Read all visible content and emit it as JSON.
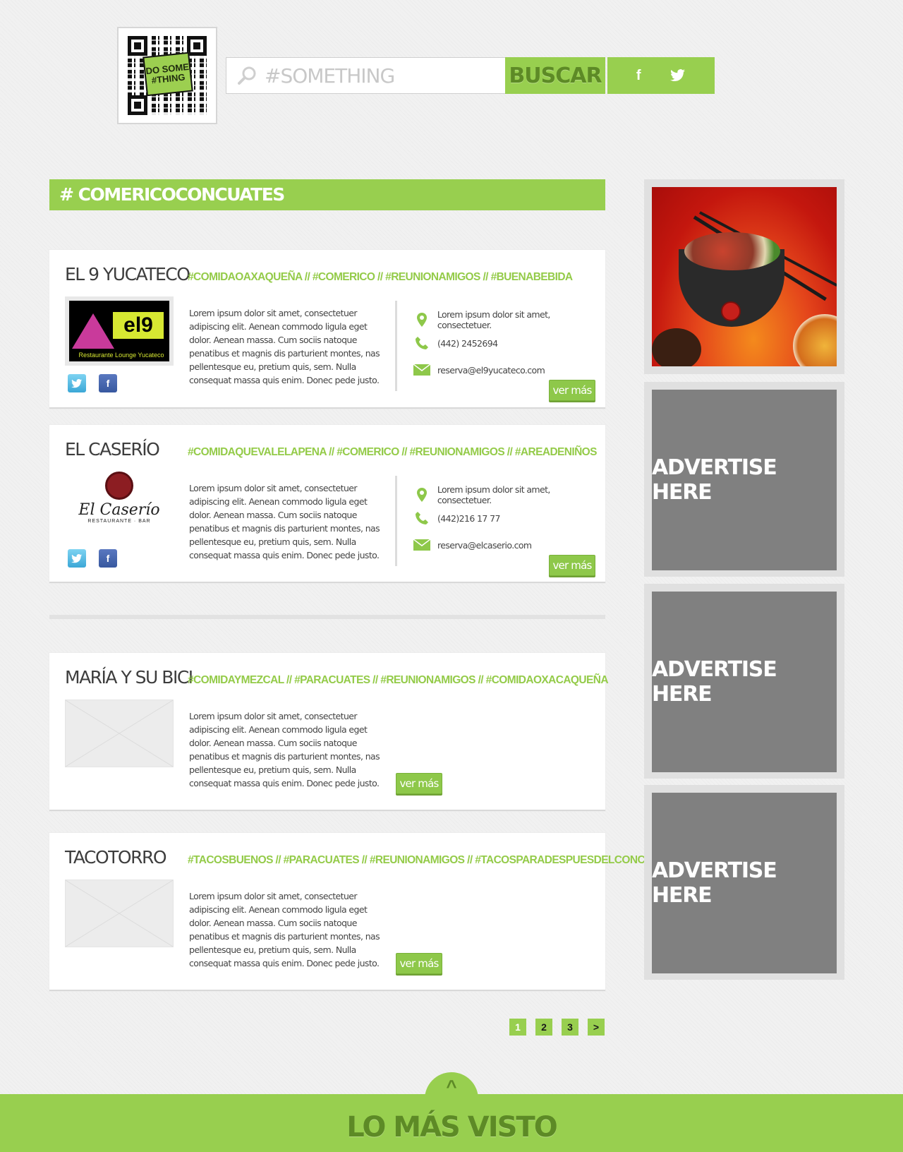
{
  "header": {
    "qr_logo_text": "DO SOME #THING",
    "search_placeholder": "#SOMETHING",
    "search_button": "BUSCAR",
    "social": {
      "facebook": "f",
      "twitter": "t"
    }
  },
  "section": {
    "title": "# COMERICOCONCUATES"
  },
  "cards": [
    {
      "name": "EL 9 YUCATECO",
      "tags": "#COMIDAOAXAQUEÑA // #COMERICO // #REUNIONAMIGOS // #BUENABEBIDA",
      "description": "Lorem ipsum dolor sit amet, consectetuer adipiscing elit. Aenean commodo ligula eget dolor. Aenean massa. Cum sociis natoque penatibus et magnis dis parturient montes, nas pellentesque eu, pretium quis, sem. Nulla consequat massa quis enim. Donec pede justo.",
      "address": "Lorem ipsum dolor sit amet, consectetuer.",
      "phone": "(442) 2452694",
      "email": "reserva@el9yucateco.com",
      "logo_main": "el9",
      "logo_sub": "Restaurante Lounge Yucateco",
      "more": "ver más"
    },
    {
      "name": "EL CASERÍO",
      "tags": "#COMIDAQUEVALELAPENA // #COMERICO // #REUNIONAMIGOS // #AREADENIÑOS",
      "description": "Lorem ipsum dolor sit amet, consectetuer adipiscing elit. Aenean commodo ligula eget dolor. Aenean massa. Cum sociis natoque penatibus et magnis dis parturient montes, nas pellentesque eu, pretium quis, sem. Nulla consequat massa quis enim. Donec pede justo.",
      "address": "Lorem ipsum dolor sit amet, consectetuer.",
      "phone": "(442)216 17 77",
      "email": "reserva@elcaserio.com",
      "logo_main": "El Caserío",
      "logo_sub": "RESTAURANTE · BAR",
      "more": "ver más"
    },
    {
      "name": "MARÍA Y SU BICI",
      "tags": "#COMIDAYMEZCAL  // #PARACUATES // #REUNIONAMIGOS // #COMIDAOXACAQUEÑA",
      "description": "Lorem ipsum dolor sit amet, consectetuer adipiscing elit. Aenean commodo ligula eget dolor. Aenean massa. Cum sociis natoque penatibus et magnis dis parturient montes, nas pellentesque eu, pretium quis, sem. Nulla consequat massa quis enim. Donec pede justo.",
      "more": "ver más"
    },
    {
      "name": "TACOTORRO",
      "tags": "#TACOSBUENOS  // #PARACUATES // #REUNIONAMIGOS //  #TACOSPARADESPUESDELCONCIERTO",
      "description": "Lorem ipsum dolor sit amet, consectetuer adipiscing elit. Aenean commodo ligula eget dolor. Aenean massa. Cum sociis natoque penatibus et magnis dis parturient montes, nas pellentesque eu, pretium quis, sem. Nulla consequat massa quis enim. Donec pede justo.",
      "more": "ver más"
    }
  ],
  "pagination": {
    "pages": [
      "1",
      "2",
      "3"
    ],
    "next": ">",
    "current": "1"
  },
  "sidebar": {
    "ads": [
      "ADVERTISE HERE",
      "ADVERTISE HERE",
      "ADVERTISE HERE"
    ]
  },
  "footer": {
    "arrow": "^",
    "title": "LO MÁS VISTO"
  },
  "colors": {
    "accent": "#98cf4f",
    "accent_dark": "#5d8a26",
    "ad_gray": "#808080",
    "text": "#3d3d3d"
  }
}
